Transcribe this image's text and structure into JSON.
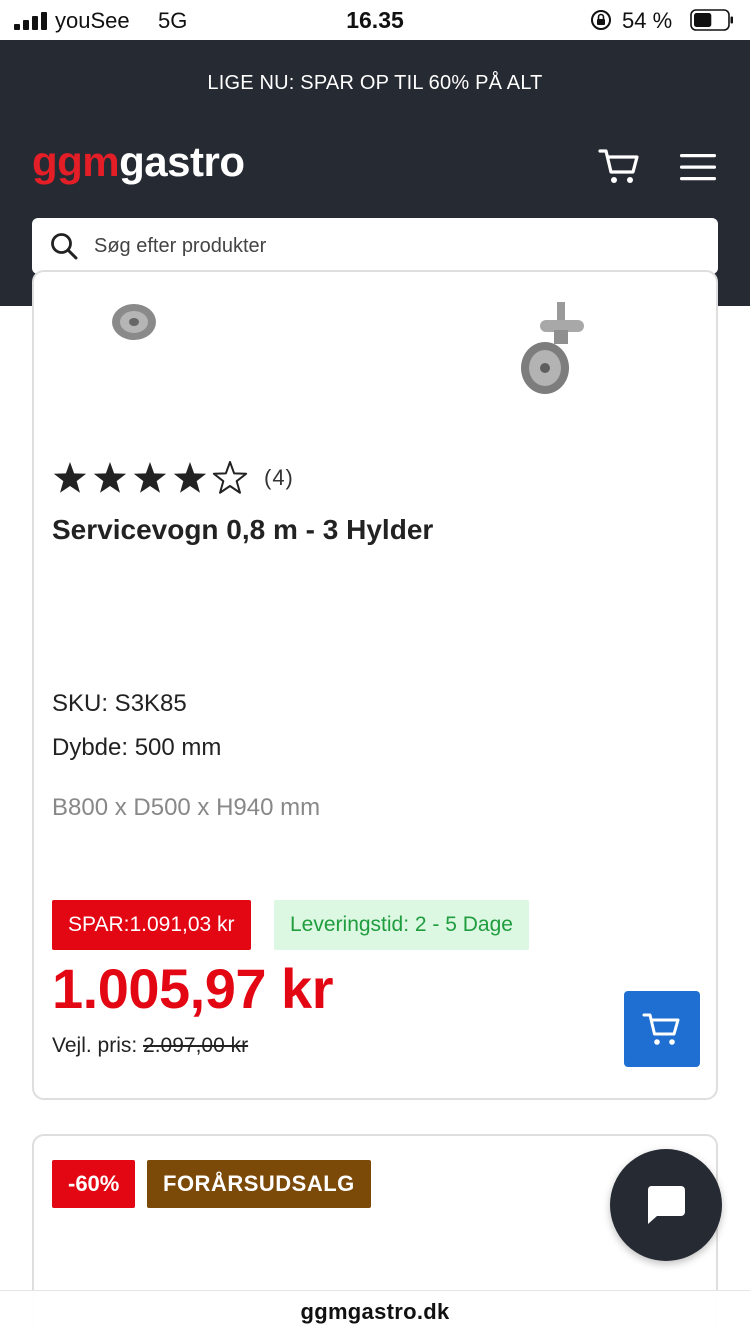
{
  "status_bar": {
    "carrier": "youSee",
    "network": "5G",
    "time": "16.35",
    "battery_percent": "54 %",
    "battery_level": 0.54
  },
  "header": {
    "promo_text": "LIGE NU: SPAR OP TIL 60% PÅ ALT",
    "logo_part1": "ggm",
    "logo_part2": "gastro",
    "brand_color": "#e41e26",
    "background_color": "#262a33",
    "cart_icon": "cart-icon",
    "menu_icon": "hamburger-menu-icon"
  },
  "search": {
    "placeholder": "Søg efter produkter",
    "icon": "search-icon"
  },
  "product": {
    "rating": 4,
    "rating_max": 5,
    "review_count": "(4)",
    "title": "Servicevogn 0,8 m - 3 Hylder",
    "sku": "SKU: S3K85",
    "depth": "Dybde: 500 mm",
    "dimensions": "B800 x D500 x H940 mm",
    "save_badge": "SPAR:1.091,03 kr",
    "delivery_badge": "Leveringstid: 2 - 5 Dage",
    "price": "1.005,97 kr",
    "rrp_label": "Vejl. pris: ",
    "rrp_value": "2.097,00 kr",
    "add_to_cart_icon": "cart-icon",
    "price_color": "#e30613",
    "cart_button_color": "#1e6fd1"
  },
  "next_product": {
    "discount_badge": "-60%",
    "sale_badge": "FORÅRSUDSALG",
    "sale_badge_color": "#7b4a09"
  },
  "chat": {
    "icon": "chat-bubble-icon"
  },
  "browser": {
    "url": "ggmgastro.dk"
  }
}
